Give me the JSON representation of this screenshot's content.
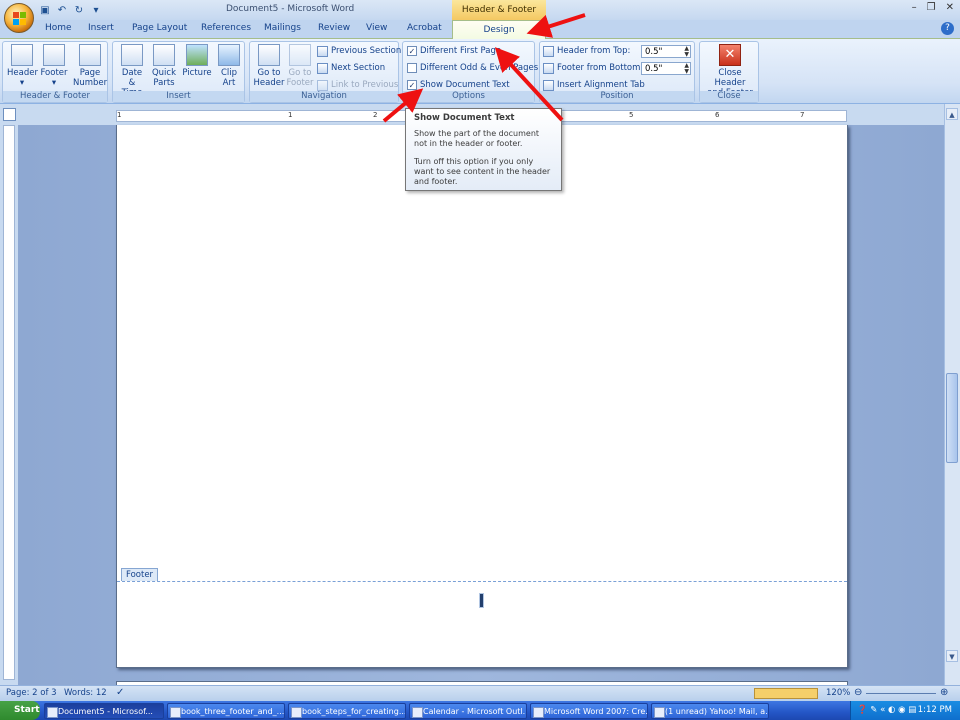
{
  "window": {
    "title": "Document5 - Microsoft Word",
    "contextual_tab": "Header & Footer Tools"
  },
  "tabs": [
    "Home",
    "Insert",
    "Page Layout",
    "References",
    "Mailings",
    "Review",
    "View",
    "Acrobat"
  ],
  "active_tab": "Design",
  "ribbon": {
    "header_footer": {
      "label": "Header & Footer",
      "header": "Header",
      "footer": "Footer",
      "page_number_l1": "Page",
      "page_number_l2": "Number"
    },
    "insert": {
      "label": "Insert",
      "date_l1": "Date",
      "date_l2": "& Time",
      "quick_l1": "Quick",
      "quick_l2": "Parts",
      "picture": "Picture",
      "clip_l1": "Clip",
      "clip_l2": "Art"
    },
    "navigation": {
      "label": "Navigation",
      "goto_header_l1": "Go to",
      "goto_header_l2": "Header",
      "goto_footer_l1": "Go to",
      "goto_footer_l2": "Footer",
      "previous_section": "Previous Section",
      "next_section": "Next Section",
      "link_to_previous": "Link to Previous"
    },
    "options": {
      "label": "Options",
      "different_first_page": "Different First Page",
      "different_odd_even": "Different Odd & Even Pages",
      "show_document_text": "Show Document Text",
      "different_first_page_checked": true,
      "different_odd_even_checked": false,
      "show_document_text_checked": true
    },
    "position": {
      "label": "Position",
      "header_from_top": "Header from Top:",
      "header_from_top_value": "0.5\"",
      "footer_from_bottom": "Footer from Bottom:",
      "footer_from_bottom_value": "0.5\"",
      "insert_alignment_tab": "Insert Alignment Tab"
    },
    "close": {
      "label": "Close",
      "close_l1": "Close Header",
      "close_l2": "and Footer"
    }
  },
  "tooltip": {
    "title": "Show Document Text",
    "p1": "Show the part of the document not in the header or footer.",
    "p2": "Turn off this option if you only want to see content in the header and footer."
  },
  "ruler": {
    "numbers": [
      "1",
      "1",
      "2",
      "5",
      "6",
      "7"
    ]
  },
  "document": {
    "footer_tab": "Footer"
  },
  "statusbar": {
    "page": "Page: 2 of 3",
    "words": "Words: 12",
    "zoom": "120%"
  },
  "taskbar": {
    "start": "Start",
    "items": [
      "Document5 - Microsof...",
      "book_three_footer_and_...",
      "book_steps_for_creating...",
      "Calendar - Microsoft Outl...",
      "Microsoft Word 2007: Cre...",
      "(1 unread) Yahoo! Mail, a..."
    ],
    "time": "1:12 PM"
  },
  "colors": {
    "accent": "#15428b",
    "arrow": "#ee1111",
    "contextual": "#f4c862"
  }
}
